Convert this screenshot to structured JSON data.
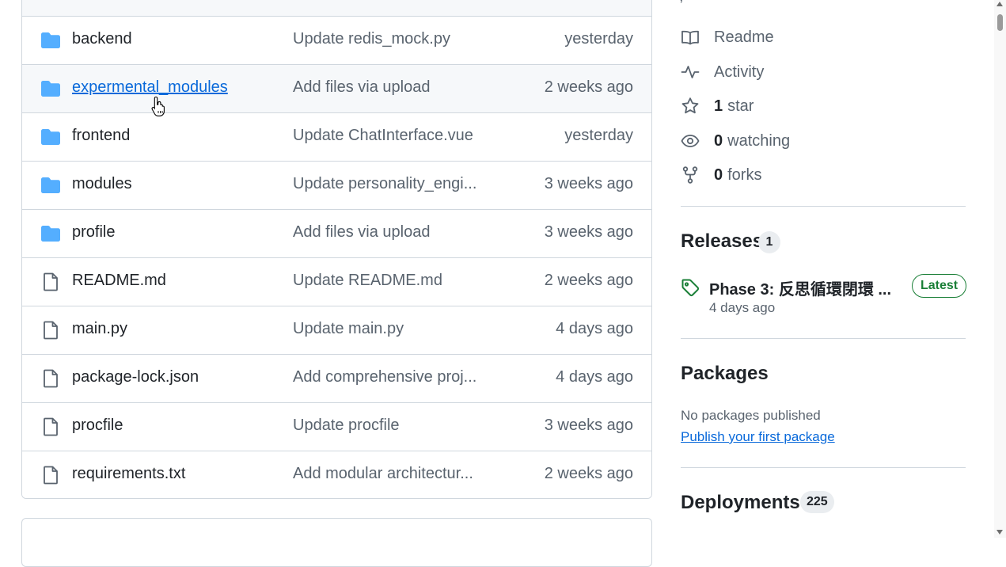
{
  "files": [
    {
      "name": "backend",
      "type": "folder",
      "commit": "Update redis_mock.py",
      "date": "yesterday"
    },
    {
      "name": "expermental_modules",
      "type": "folder",
      "commit": "Add files via upload",
      "date": "2 weeks ago"
    },
    {
      "name": "frontend",
      "type": "folder",
      "commit": "Update ChatInterface.vue",
      "date": "yesterday"
    },
    {
      "name": "modules",
      "type": "folder",
      "commit": "Update personality_engi...",
      "date": "3 weeks ago"
    },
    {
      "name": "profile",
      "type": "folder",
      "commit": "Add files via upload",
      "date": "3 weeks ago"
    },
    {
      "name": "README.md",
      "type": "file",
      "commit": "Update README.md",
      "date": "2 weeks ago"
    },
    {
      "name": "main.py",
      "type": "file",
      "commit": "Update main.py",
      "date": "4 days ago"
    },
    {
      "name": "package-lock.json",
      "type": "file",
      "commit": "Add comprehensive proj...",
      "date": "4 days ago"
    },
    {
      "name": "procfile",
      "type": "file",
      "commit": "Update procfile",
      "date": "3 weeks ago"
    },
    {
      "name": "requirements.txt",
      "type": "file",
      "commit": "Add modular architectur...",
      "date": "2 weeks ago"
    }
  ],
  "sidebar": {
    "readme": "Readme",
    "activity": "Activity",
    "stars": {
      "count": "1",
      "label": "star"
    },
    "watching": {
      "count": "0",
      "label": "watching"
    },
    "forks": {
      "count": "0",
      "label": "forks"
    },
    "releases": {
      "title": "Releases",
      "count": "1",
      "latest_name": "Phase 3: 反思循環閉環 ...",
      "latest_badge": "Latest",
      "latest_date": "4 days ago"
    },
    "packages": {
      "title": "Packages",
      "empty_text": "No packages published",
      "publish_link": "Publish your first package"
    },
    "deployments": {
      "title": "Deployments",
      "count": "225"
    }
  },
  "colors": {
    "folder": "#54aeff",
    "link": "#0969da",
    "latest": "#1a7f37",
    "muted": "#59636e"
  },
  "icons": [
    "folder-icon",
    "file-icon",
    "book-icon",
    "pulse-icon",
    "star-icon",
    "eye-icon",
    "fork-icon",
    "tag-icon",
    "hand-cursor-icon"
  ],
  "hovered_file": "expermental_modules"
}
